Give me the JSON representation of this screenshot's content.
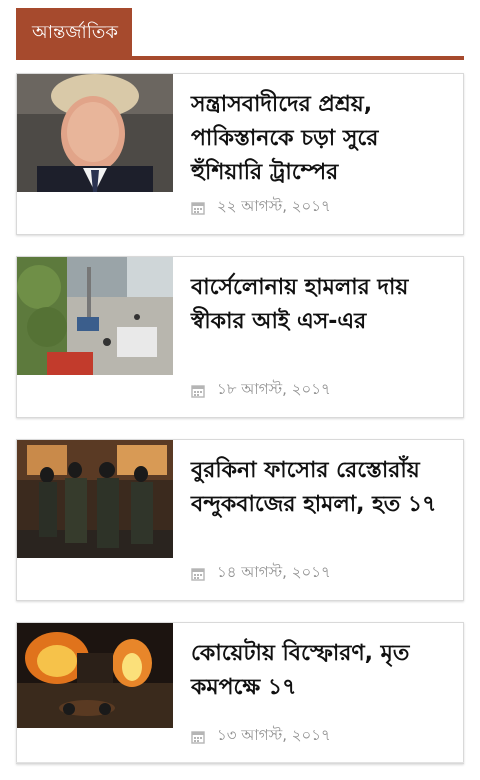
{
  "section": {
    "title": "আন্তর্জাতিক",
    "accent_color": "#a64a2d"
  },
  "articles": [
    {
      "headline": "সন্ত্রাসবাদীদের প্রশ্রয়, পাকিস্তানকে চড়া সুরে হুঁশিয়ারি ট্রাম্পের",
      "date": "২২ আগস্ট, ২০১৭",
      "date_icon": "calendar-icon"
    },
    {
      "headline": "বার্সেলোনায় হামলার দায় স্বীকার আই এস-এর",
      "date": "১৮ আগস্ট, ২০১৭",
      "date_icon": "calendar-icon"
    },
    {
      "headline": "বুরকিনা ফাসোর রেস্তোরাঁয় বন্দুকবাজের হামলা, হত ১৭",
      "date": "১৪ আগস্ট, ২০১৭",
      "date_icon": "calendar-icon"
    },
    {
      "headline": "কোয়েটায় বিস্ফোরণ, মৃত কমপক্ষে ১৭",
      "date": "১৩ আগস্ট, ২০১৭",
      "date_icon": "calendar-icon"
    }
  ]
}
